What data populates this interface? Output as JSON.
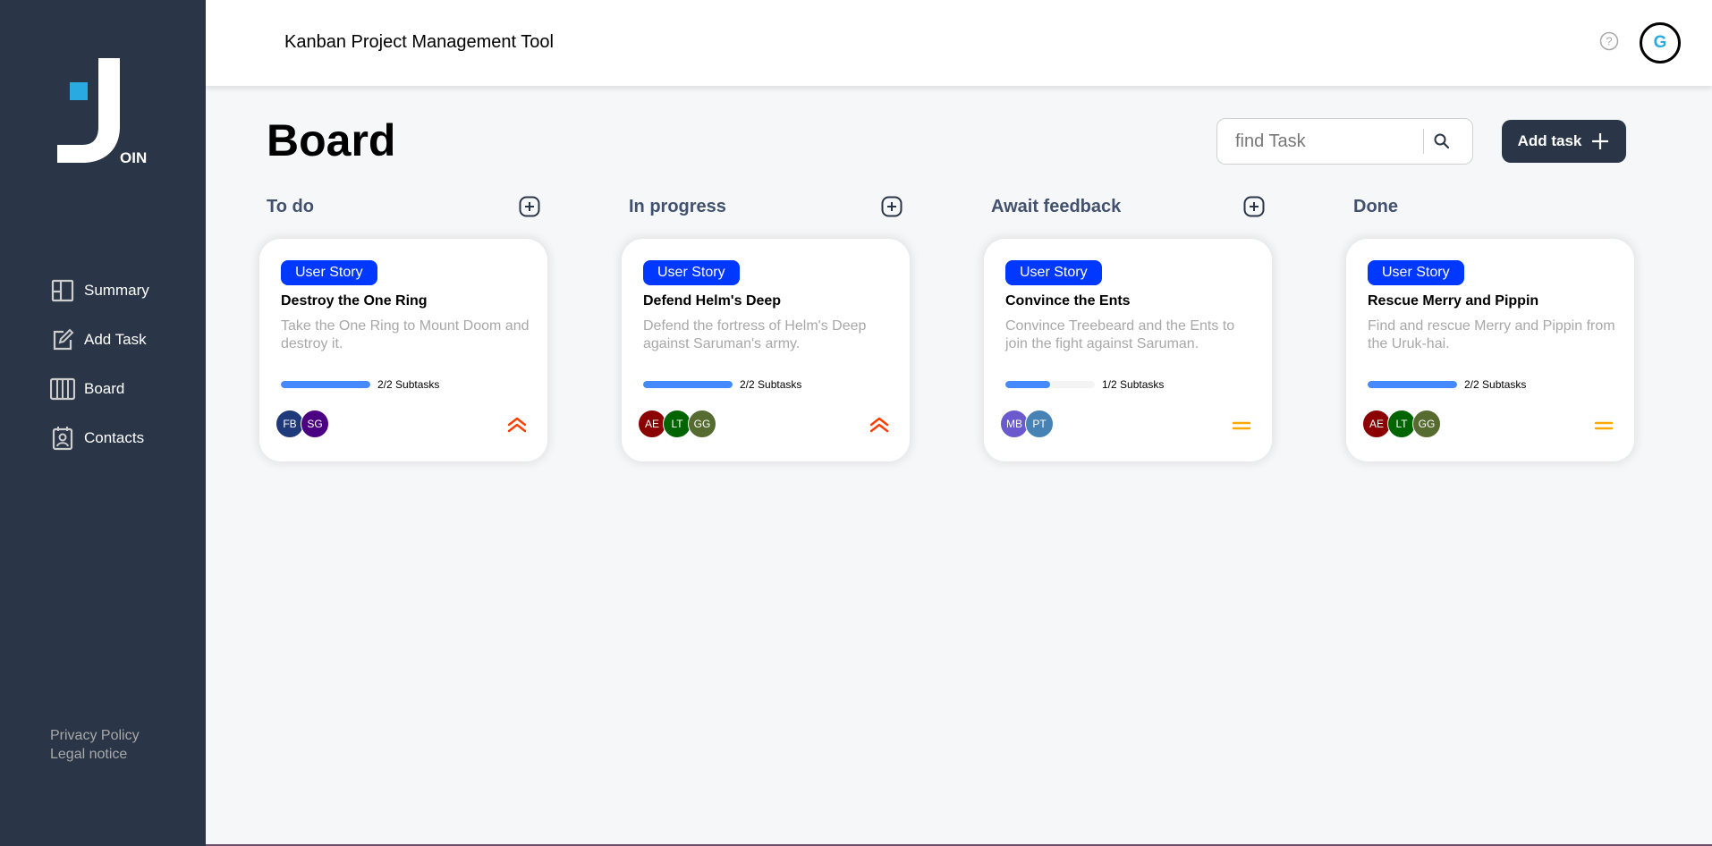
{
  "app": {
    "header_title": "Kanban Project Management Tool",
    "logo_text": "OIN",
    "user_initial": "G"
  },
  "sidebar": {
    "items": [
      {
        "label": "Summary",
        "icon": "summary-icon"
      },
      {
        "label": "Add Task",
        "icon": "add-task-icon"
      },
      {
        "label": "Board",
        "icon": "board-icon"
      },
      {
        "label": "Contacts",
        "icon": "contacts-icon"
      }
    ],
    "footer": {
      "privacy": "Privacy Policy",
      "legal": "Legal notice"
    }
  },
  "board": {
    "title": "Board",
    "search_placeholder": "find Task",
    "add_task_label": "Add task"
  },
  "columns": [
    {
      "title": "To do",
      "has_add": true
    },
    {
      "title": "In progress",
      "has_add": true
    },
    {
      "title": "Await feedback",
      "has_add": true
    },
    {
      "title": "Done",
      "has_add": false
    }
  ],
  "cards": [
    {
      "category": "User Story",
      "title": "Destroy the One Ring",
      "description": "Take the One Ring to Mount Doom and destroy it.",
      "subtasks_done": 2,
      "subtasks_total": 2,
      "subtasks_label": "2/2 Subtasks",
      "assignees": [
        {
          "initials": "FB",
          "color": "#1f3a7a"
        },
        {
          "initials": "SG",
          "color": "#4b0082"
        }
      ],
      "priority": "urgent"
    },
    {
      "category": "User Story",
      "title": "Defend Helm's Deep",
      "description": "Defend the fortress of Helm's Deep against Saruman's army.",
      "subtasks_done": 2,
      "subtasks_total": 2,
      "subtasks_label": "2/2 Subtasks",
      "assignees": [
        {
          "initials": "AE",
          "color": "#8b0000"
        },
        {
          "initials": "LT",
          "color": "#006400"
        },
        {
          "initials": "GG",
          "color": "#556b2f"
        }
      ],
      "priority": "urgent"
    },
    {
      "category": "User Story",
      "title": "Convince the Ents",
      "description": "Convince Treebeard and the Ents to join the fight against Saruman.",
      "subtasks_done": 1,
      "subtasks_total": 2,
      "subtasks_label": "1/2 Subtasks",
      "assignees": [
        {
          "initials": "MB",
          "color": "#6a5acd"
        },
        {
          "initials": "PT",
          "color": "#4682b4"
        }
      ],
      "priority": "medium"
    },
    {
      "category": "User Story",
      "title": "Rescue Merry and Pippin",
      "description": "Find and rescue Merry and Pippin from the Uruk-hai.",
      "subtasks_done": 2,
      "subtasks_total": 2,
      "subtasks_label": "2/2 Subtasks",
      "assignees": [
        {
          "initials": "AE",
          "color": "#8b0000"
        },
        {
          "initials": "LT",
          "color": "#006400"
        },
        {
          "initials": "GG",
          "color": "#556b2f"
        }
      ],
      "priority": "medium"
    }
  ],
  "colors": {
    "sidebar": "#2a3647",
    "badge": "#0038ff",
    "progress": "#4589ff",
    "urgent": "#ff3d00",
    "medium": "#ffa800"
  }
}
